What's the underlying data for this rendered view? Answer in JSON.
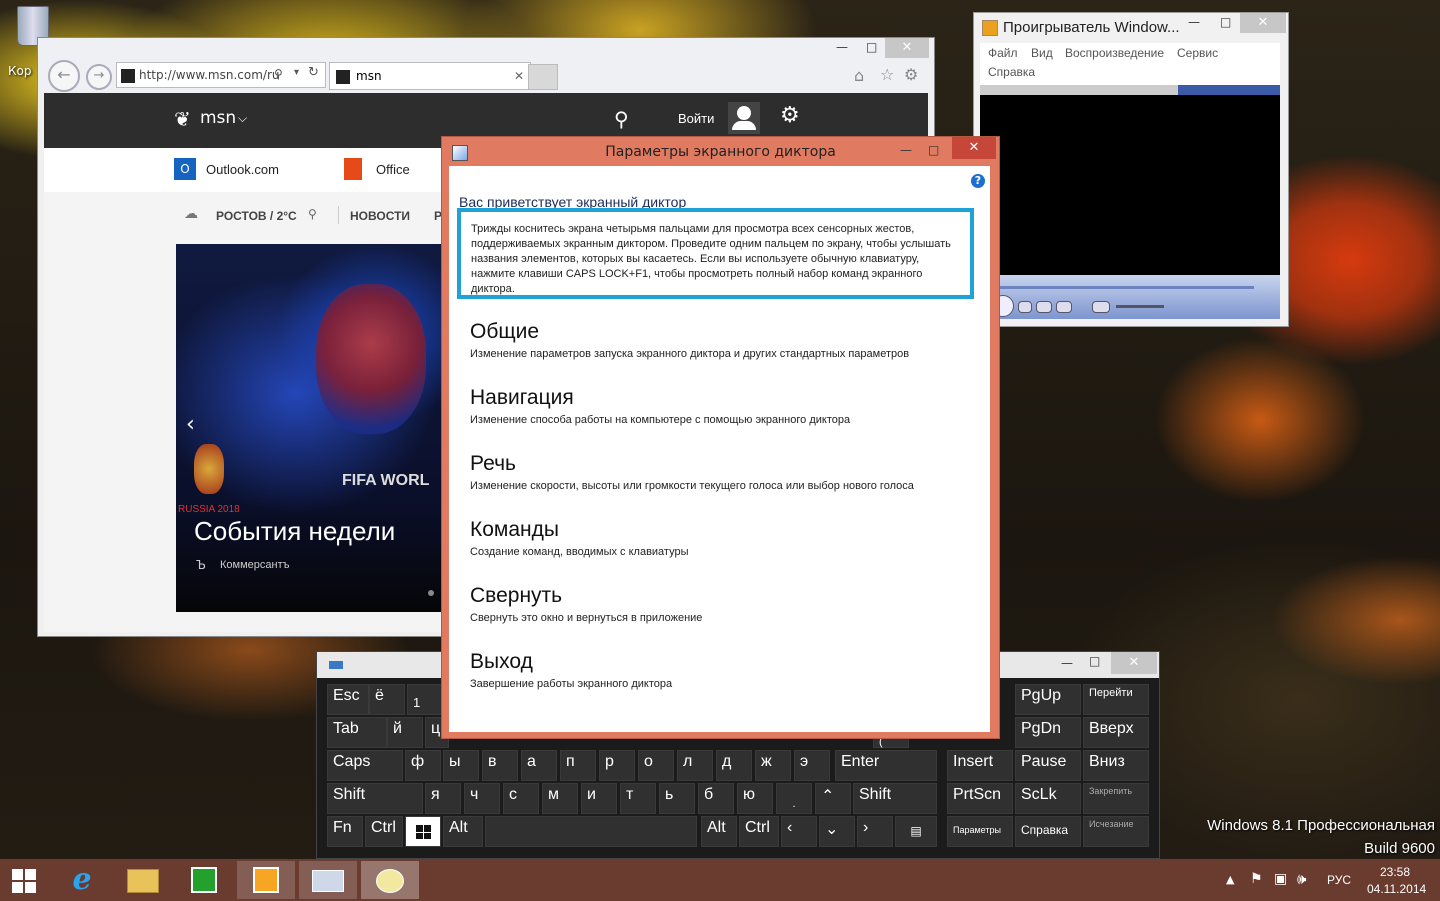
{
  "desktop": {
    "recycle_label": "Кор"
  },
  "ie": {
    "url": "http://www.msn.com/ru",
    "tab_title": "msn",
    "msn": {
      "logo": "msn",
      "signin": "Войти",
      "nav_outlook": "Outlook.com",
      "nav_office": "Office",
      "weather": "РОСТОВ / 2°C",
      "news": "НОВОСТИ",
      "news_more": "Р",
      "hero_title": "События недели",
      "hero_source": "Коммерсантъ",
      "hero_caption_a": "FIFA WORL",
      "hero_caption_b": "RUSSIA 2018"
    }
  },
  "wmp": {
    "title": "Проигрыватель Window...",
    "menu": [
      "Файл",
      "Вид",
      "Воспроизведение",
      "Сервис",
      "Справка"
    ]
  },
  "narrator": {
    "title": "Параметры экранного диктора",
    "welcome": "Вас приветствует экранный диктор",
    "intro": "Трижды коснитесь экрана четырьмя пальцами для просмотра всех сенсорных жестов, поддерживаемых экранным диктором. Проведите одним пальцем по экрану, чтобы услышать названия элементов, которых вы касаетесь. Если вы используете обычную клавиатуру, нажмите клавиши CAPS LOCK+F1, чтобы просмотреть полный набор команд экранного диктора.",
    "sections": [
      {
        "title": "Общие",
        "desc": "Изменение параметров запуска экранного диктора и других стандартных параметров"
      },
      {
        "title": "Навигация",
        "desc": "Изменение способа работы на компьютере с помощью экранного диктора"
      },
      {
        "title": "Речь",
        "desc": "Изменение скорости, высоты или громкости текущего голоса или выбор нового голоса"
      },
      {
        "title": "Команды",
        "desc": "Создание команд, вводимых с клавиатуры"
      },
      {
        "title": "Свернуть",
        "desc": "Свернуть это окно и вернуться в приложение"
      },
      {
        "title": "Выход",
        "desc": "Завершение работы экранного диктора"
      }
    ]
  },
  "keyboard": {
    "row1": [
      "Esc",
      "ё",
      "1",
      "PgUp",
      "Перейти"
    ],
    "row2": [
      "Tab",
      "й",
      "ц",
      "(",
      "PgDn",
      "Вверх"
    ],
    "row3": [
      "Caps",
      "ф",
      "ы",
      "в",
      "а",
      "п",
      "р",
      "о",
      "л",
      "д",
      "ж",
      "э",
      "Enter",
      "Insert",
      "Pause",
      "Вниз"
    ],
    "row4": [
      "Shift",
      "я",
      "ч",
      "с",
      "м",
      "и",
      "т",
      "ь",
      "б",
      "ю",
      ".",
      "Shift",
      "PrtScn",
      "ScLk",
      "Закрепить"
    ],
    "row5": [
      "Fn",
      "Ctrl",
      "Alt",
      "Alt",
      "Ctrl",
      "Параметры",
      "Справка",
      "Исчезание"
    ]
  },
  "watermark": {
    "line1": "Windows 8.1 Профессиональная",
    "line2": "Build 9600"
  },
  "taskbar": {
    "lang": "РУС",
    "time": "23:58",
    "date": "04.11.2014"
  },
  "colors": {
    "narrator_border": "#e07a60",
    "intro_highlight": "#1fa3d6",
    "taskbar": "#6a3b2f",
    "msn_dark": "#2d2d2d"
  }
}
